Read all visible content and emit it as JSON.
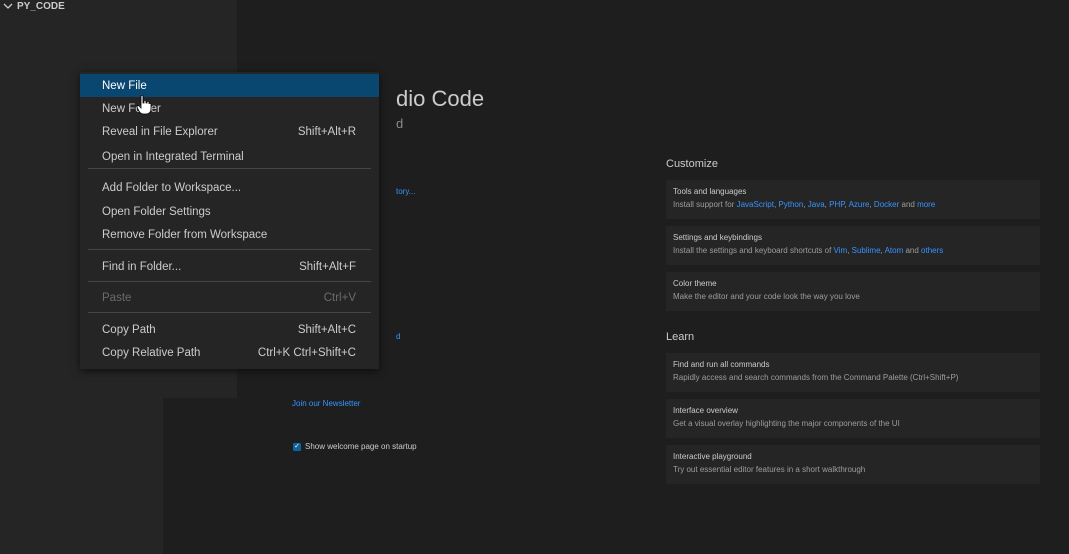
{
  "explorer": {
    "folder_name": "PY_CODE"
  },
  "welcome": {
    "title_fragment": "dio Code",
    "subtitle_fragment": "d",
    "link_fragment_1": "tory...",
    "link_fragment_2": "d",
    "newsletter_link": "Join our Newsletter",
    "show_on_startup_label": "Show welcome page on startup",
    "show_on_startup_checked": true
  },
  "customize": {
    "heading": "Customize",
    "cards": [
      {
        "title": "Tools and languages",
        "desc_prefix": "Install support for ",
        "links": [
          "JavaScript",
          "Python",
          "Java",
          "PHP",
          "Azure",
          "Docker"
        ],
        "desc_and": " and ",
        "more": "more"
      },
      {
        "title": "Settings and keybindings",
        "desc_prefix": "Install the settings and keyboard shortcuts of ",
        "links": [
          "Vim",
          "Sublime",
          "Atom"
        ],
        "desc_and": " and ",
        "more": "others"
      },
      {
        "title": "Color theme",
        "desc": "Make the editor and your code look the way you love"
      }
    ]
  },
  "learn": {
    "heading": "Learn",
    "cards": [
      {
        "title": "Find and run all commands",
        "desc": "Rapidly access and search commands from the Command Palette (Ctrl+Shift+P)"
      },
      {
        "title": "Interface overview",
        "desc": "Get a visual overlay highlighting the major components of the UI"
      },
      {
        "title": "Interactive playground",
        "desc": "Try out essential editor features in a short walkthrough"
      }
    ]
  },
  "context_menu": {
    "items": [
      {
        "label": "New File",
        "shortcut": ""
      },
      {
        "label": "New Folder",
        "shortcut": ""
      },
      {
        "label": "Reveal in File Explorer",
        "shortcut": "Shift+Alt+R"
      },
      {
        "label": "Open in Integrated Terminal",
        "shortcut": ""
      },
      {
        "label": "Add Folder to Workspace...",
        "shortcut": ""
      },
      {
        "label": "Open Folder Settings",
        "shortcut": ""
      },
      {
        "label": "Remove Folder from Workspace",
        "shortcut": ""
      },
      {
        "label": "Find in Folder...",
        "shortcut": "Shift+Alt+F"
      },
      {
        "label": "Paste",
        "shortcut": "Ctrl+V"
      },
      {
        "label": "Copy Path",
        "shortcut": "Shift+Alt+C"
      },
      {
        "label": "Copy Relative Path",
        "shortcut": "Ctrl+K Ctrl+Shift+C"
      }
    ]
  },
  "colors": {
    "accent": "#094771",
    "link": "#3794ff",
    "editor_bg": "#1e1e1e",
    "sidebar_bg": "#252526"
  }
}
